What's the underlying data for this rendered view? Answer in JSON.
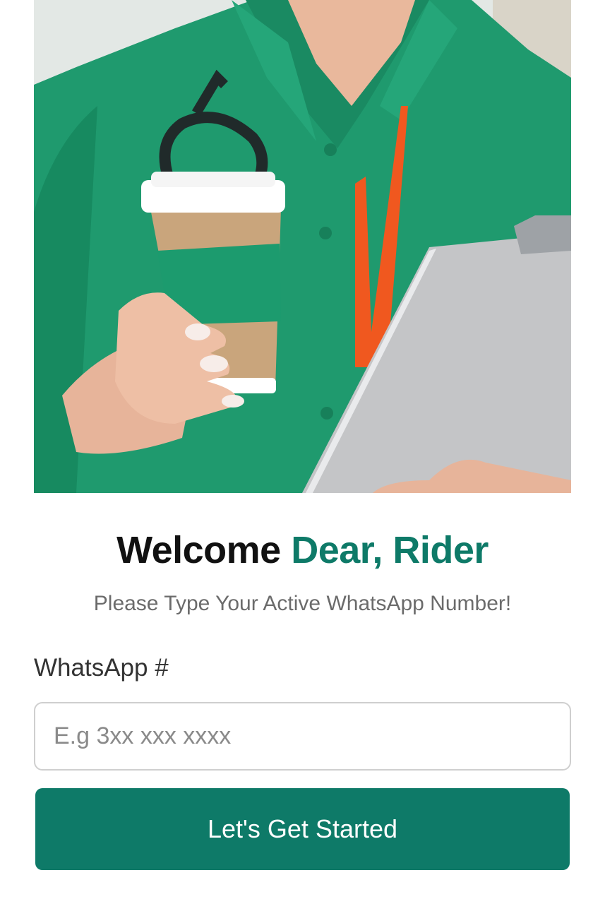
{
  "hero": {
    "image": "rider-holding-coffee-and-clipboard"
  },
  "welcome": {
    "title_prefix": "Welcome",
    "title_highlight": "Dear, Rider",
    "subtitle": "Please Type Your Active WhatsApp Number!"
  },
  "form": {
    "phone_label": "WhatsApp #",
    "phone_placeholder": "E.g 3xx xxx xxxx",
    "phone_value": "",
    "submit_label": "Let's Get Started"
  },
  "colors": {
    "accent": "#0e7a68",
    "title_text": "#111111",
    "subtitle_text": "#6b6b6b",
    "input_border": "#cfcfcf"
  }
}
